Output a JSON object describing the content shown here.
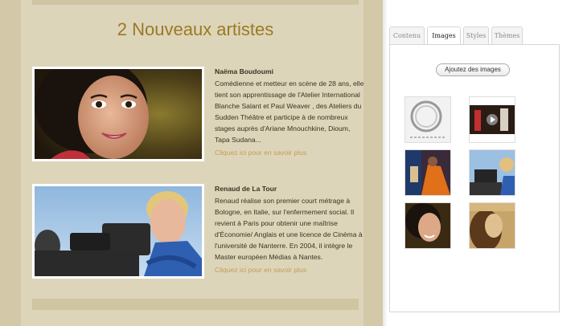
{
  "newsletter": {
    "section_title": "2 Nouveaux artistes",
    "artists": [
      {
        "name": "Naëma Boudoumi",
        "bio": "Comédienne et metteur en scène de 28 ans, elle tient son apprentissage de l'Atelier International Blanche Salant et Paul Weaver , des Ateliers du Sudden Théâtre et participe à de nombreux stages auprès d'Ariane Mnouchkine, Dioum, Tapa Sudana...",
        "link": "Cliquez ici pour en savoir plus"
      },
      {
        "name": "Renaud de La Tour",
        "bio": "Renaud réalise son premier court métrage à Bologne, en Italie, sur l'enfermement social. Il revient à Paris pour obtenir une maîtrise d'Économie/ Anglais et une licence de Cinéma à l'université de Nanterre. En 2004, il intègre le Master européen Médias à Nantes.",
        "link": "Cliquez ici pour en savoir plus"
      }
    ]
  },
  "panel": {
    "tabs": [
      "Contenu",
      "Images",
      "Styles",
      "Thèmes"
    ],
    "active_tab": "Images",
    "add_images_button": "Ajoutez des images"
  },
  "colors": {
    "title": "#9a7a25",
    "link": "#c29d55",
    "background": "#ddd5b9"
  }
}
